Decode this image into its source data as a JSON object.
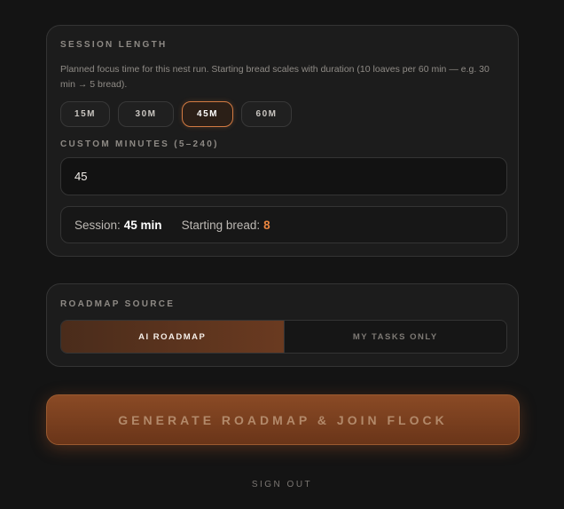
{
  "session": {
    "label": "SESSION LENGTH",
    "description": "Planned focus time for this nest run. Starting bread scales with duration (10 loaves per 60 min — e.g. 30 min → 5 bread).",
    "presets": [
      {
        "label": "15M",
        "selected": false
      },
      {
        "label": "30M",
        "selected": false
      },
      {
        "label": "45M",
        "selected": true
      },
      {
        "label": "60M",
        "selected": false
      }
    ],
    "custom_label": "CUSTOM MINUTES (5–240)",
    "custom_value": "45",
    "summary": {
      "session_label": "Session:",
      "session_value": "45 min",
      "bread_label": "Starting bread:",
      "bread_value": "8"
    }
  },
  "roadmap": {
    "label": "ROADMAP SOURCE",
    "options": [
      {
        "label": "AI ROADMAP",
        "selected": true
      },
      {
        "label": "MY TASKS ONLY",
        "selected": false
      }
    ]
  },
  "cta_label": "GENERATE ROADMAP & JOIN FLOCK",
  "signout_label": "SIGN OUT",
  "colors": {
    "accent": "#d27a42",
    "bread_value": "#e9853f",
    "background": "#141414"
  }
}
